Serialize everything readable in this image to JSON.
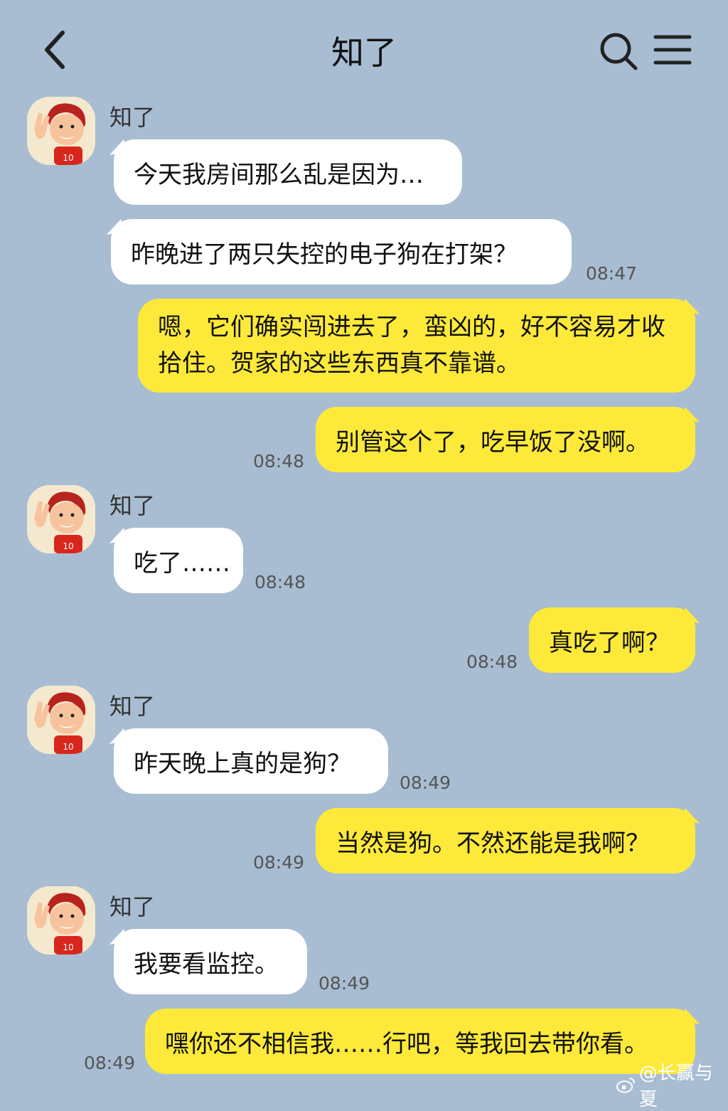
{
  "header": {
    "title": "知了",
    "back_icon": "chevron-left-icon",
    "search_icon": "search-icon",
    "menu_icon": "hamburger-menu-icon"
  },
  "messages": [
    {
      "side": "in",
      "sender": "知了",
      "avatar": "cartoon-basketball-player-avatar",
      "text": "今天我房间那么乱是因为…"
    },
    {
      "side": "in",
      "text": "昨晚进了两只失控的电子狗在打架？",
      "time": "08:47"
    },
    {
      "side": "out",
      "text": "嗯，它们确实闯进去了，蛮凶的，好不容易才收拾住。贺家的这些东西真不靠谱。"
    },
    {
      "side": "out",
      "text": "别管这个了，吃早饭了没啊。",
      "time": "08:48"
    },
    {
      "side": "in",
      "sender": "知了",
      "text": "吃了……",
      "time": "08:48"
    },
    {
      "side": "out",
      "text": "真吃了啊？",
      "time": "08:48"
    },
    {
      "side": "in",
      "sender": "知了",
      "text": "昨天晚上真的是狗？",
      "time": "08:49"
    },
    {
      "side": "out",
      "text": "当然是狗。不然还能是我啊？",
      "time": "08:49"
    },
    {
      "side": "in",
      "sender": "知了",
      "text": "我要看监控。",
      "time": "08:49"
    },
    {
      "side": "out",
      "text": "嘿你还不相信我……行吧，等我回去带你看。",
      "time": "08:49"
    }
  ],
  "watermark": {
    "text": "@长赢与夏",
    "icon": "weibo-icon"
  },
  "colors": {
    "background": "#a8bdd2",
    "incoming_bubble": "#ffffff",
    "outgoing_bubble": "#fde93a"
  }
}
